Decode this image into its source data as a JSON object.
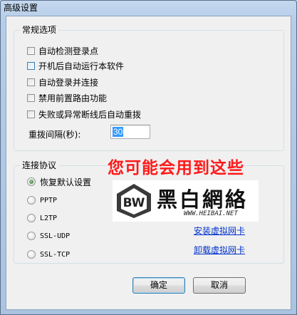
{
  "window": {
    "title": "高级设置"
  },
  "general": {
    "title": "常规选项",
    "options": [
      {
        "label": "自动检测登录点",
        "checked": false
      },
      {
        "label": "开机后自动运行本软件",
        "checked": false
      },
      {
        "label": "自动登录并连接",
        "checked": false
      },
      {
        "label": "禁用前置路由功能",
        "checked": false
      },
      {
        "label": "失败或异常断线后自动重拨",
        "checked": false
      }
    ],
    "interval_label": "重拨间隔(秒):",
    "interval_value": "30"
  },
  "protocol": {
    "title": "连接协议",
    "options": [
      {
        "label": "恢复默认设置",
        "selected": true
      },
      {
        "label": "PPTP",
        "selected": false
      },
      {
        "label": "L2TP",
        "selected": false
      },
      {
        "label": "SSL-UDP",
        "selected": false
      },
      {
        "label": "SSL-TCP",
        "selected": false
      }
    ],
    "install_link": "安装虚拟网卡",
    "uninstall_link": "卸载虚拟网卡"
  },
  "overlay": {
    "caption": "您可能会用到这些",
    "caption_color": "#ff1a1a",
    "logo_letters": "BW",
    "logo_name": "黑白網絡",
    "logo_url": "WWW.HEIBAI.NET"
  },
  "buttons": {
    "ok": "确定",
    "cancel": "取消"
  }
}
